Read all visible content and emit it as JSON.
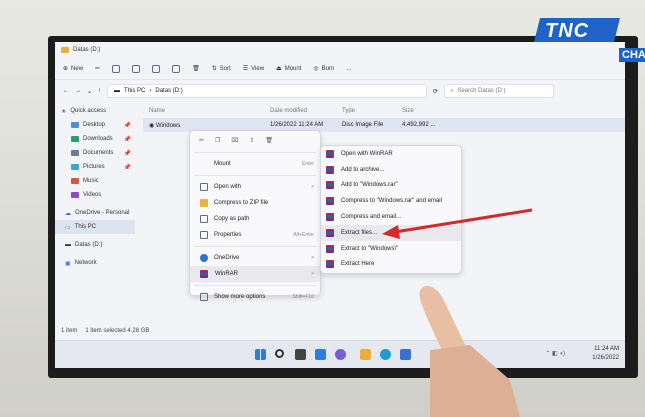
{
  "explorer": {
    "window_title": "Datas (D:)",
    "toolbar": [
      "New",
      "Sort",
      "View",
      "Mount",
      "Burn",
      "..."
    ],
    "breadcrumb": [
      "This PC",
      "Datas (D:)"
    ],
    "search_placeholder": "Search Datas (D:)",
    "nav": [
      {
        "label": "Quick access"
      },
      {
        "label": "Desktop"
      },
      {
        "label": "Downloads"
      },
      {
        "label": "Documents"
      },
      {
        "label": "Pictures"
      },
      {
        "label": "Music"
      },
      {
        "label": "Videos"
      },
      {
        "label": "OneDrive - Personal"
      },
      {
        "label": "This PC"
      },
      {
        "label": "Datas (D:)"
      },
      {
        "label": "Network"
      }
    ],
    "columns": [
      "Name",
      "Date modified",
      "Type",
      "Size"
    ],
    "file": {
      "name": "Windows",
      "date": "1/26/2022 11:24 AM",
      "type": "Disc Image File",
      "size": "4,492,992 ..."
    },
    "status_items": "1 item",
    "status_selected": "1 item selected  4.28 GB"
  },
  "context_menu": {
    "items": [
      {
        "label": "Mount",
        "shortcut": "Enter"
      },
      {
        "label": "Open with",
        "arrow": ">"
      },
      {
        "label": "Compress to ZIP file"
      },
      {
        "label": "Copy as path"
      },
      {
        "label": "Properties",
        "shortcut": "Alt+Enter"
      },
      {
        "label": "OneDrive",
        "arrow": ">"
      },
      {
        "label": "WinRAR",
        "arrow": ">"
      },
      {
        "label": "Show more options",
        "shortcut": "Shift+F10"
      }
    ]
  },
  "winrar_menu": {
    "items": [
      "Open with WinRAR",
      "Add to archive...",
      "Add to \"Windows.rar\"",
      "Compress to \"Windows.rar\" and email",
      "Compress and email...",
      "Extract files...",
      "Extract to \"Windows\\\"",
      "Extract Here"
    ]
  },
  "taskbar": {
    "time": "11:24 AM",
    "date": "1/26/2022"
  },
  "watermark": {
    "text": "TNC",
    "sub": "CHAN"
  },
  "colors": {
    "arrow": "#d42a2a",
    "selection": "#dfe6f2",
    "brand": "#1f63c9"
  }
}
